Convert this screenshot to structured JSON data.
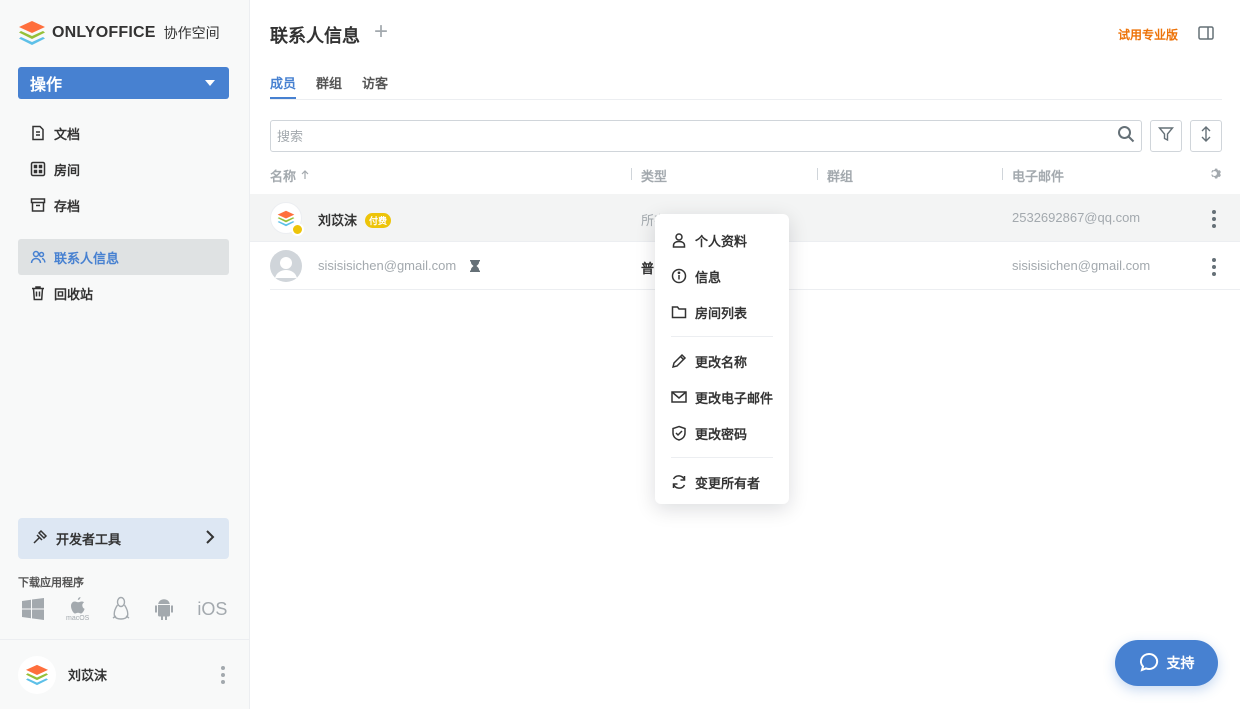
{
  "app": {
    "brand": "ONLYOFFICE",
    "brand_sub": "协作空间"
  },
  "sidebar": {
    "action_label": "操作",
    "items": [
      {
        "label": "文档",
        "icon": "document-icon"
      },
      {
        "label": "房间",
        "icon": "rooms-icon"
      },
      {
        "label": "存档",
        "icon": "archive-icon"
      },
      {
        "label": "联系人信息",
        "icon": "contacts-icon",
        "active": true
      },
      {
        "label": "回收站",
        "icon": "trash-icon"
      }
    ],
    "dev_tools": "开发者工具",
    "download_title": "下载应用程序",
    "download_ios": "iOS",
    "download_macos": "macOS",
    "user_name": "刘苡沫"
  },
  "header": {
    "title": "联系人信息",
    "trial": "试用专业版"
  },
  "tabs": [
    {
      "label": "成员",
      "active": true
    },
    {
      "label": "群组"
    },
    {
      "label": "访客"
    }
  ],
  "search": {
    "placeholder": "搜索",
    "value": ""
  },
  "table": {
    "columns": [
      "名称",
      "类型",
      "群组",
      "电子邮件"
    ],
    "rows": [
      {
        "name": "刘苡沫",
        "badge": "付费",
        "type": "所有者",
        "group": "",
        "email": "2532692867@qq.com"
      },
      {
        "name": "sisisisichen@gmail.com",
        "type": "普",
        "group": "",
        "email": "sisisisichen@gmail.com",
        "pending": true
      }
    ]
  },
  "context_menu": {
    "items": [
      {
        "label": "个人资料",
        "icon": "person-icon"
      },
      {
        "label": "信息",
        "icon": "info-icon"
      },
      {
        "label": "房间列表",
        "icon": "folder-icon"
      },
      {
        "label": "更改名称",
        "icon": "pencil-icon"
      },
      {
        "label": "更改电子邮件",
        "icon": "mail-icon"
      },
      {
        "label": "更改密码",
        "icon": "shield-icon"
      },
      {
        "label": "变更所有者",
        "icon": "refresh-icon"
      }
    ]
  },
  "support": {
    "label": "支持"
  },
  "colors": {
    "accent": "#4781d1",
    "trial": "#ed7309",
    "paid_badge": "#edc409"
  }
}
